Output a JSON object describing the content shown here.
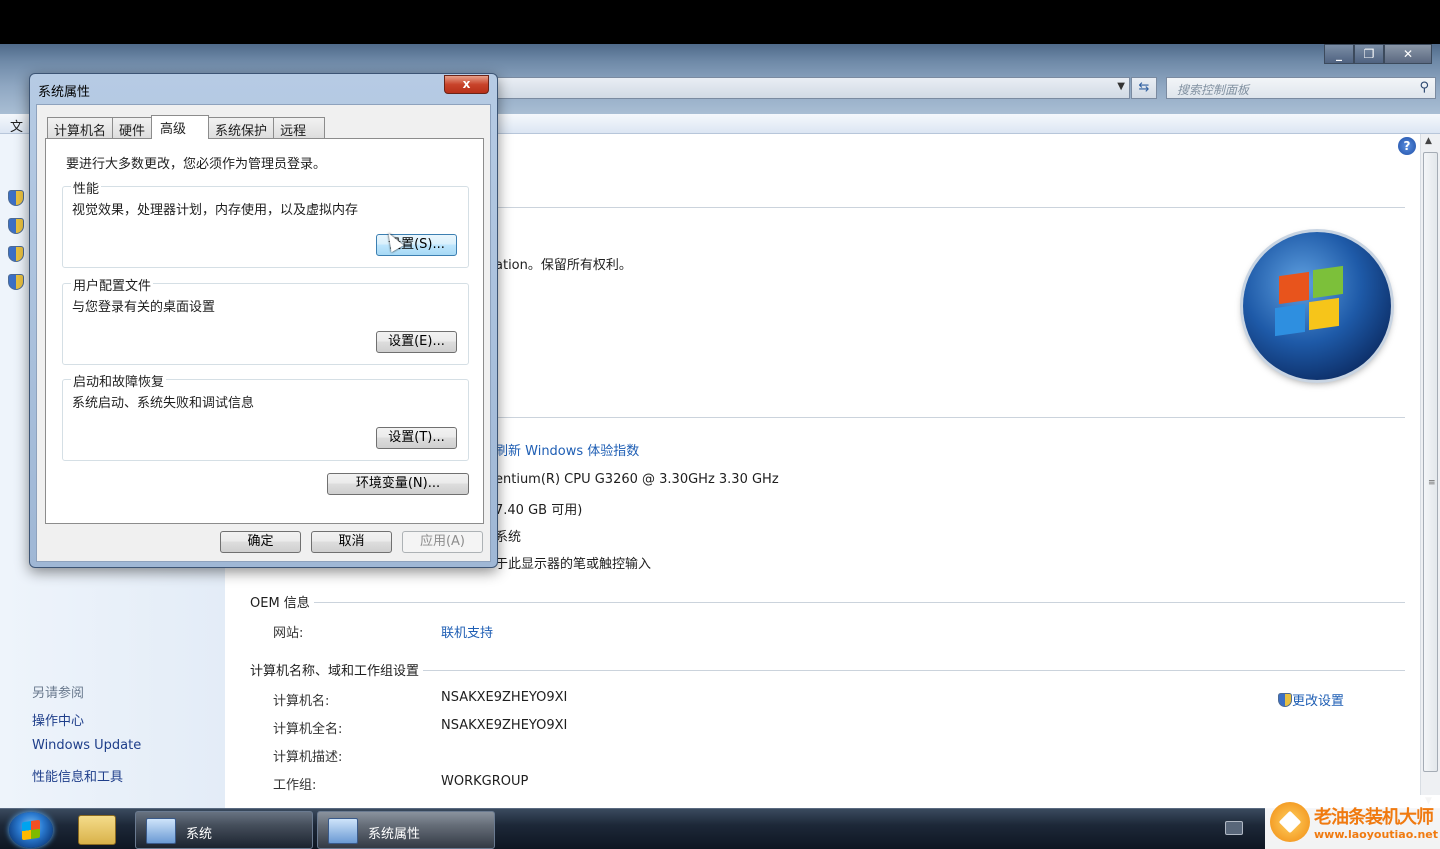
{
  "explorer": {
    "search_placeholder": "搜索控制面板",
    "menu_file": "文",
    "left": {
      "see_also": "另请参阅",
      "links": [
        "操作中心",
        "Windows Update",
        "性能信息和工具"
      ]
    },
    "system_info": {
      "copyright_fragment": "ation。保留所有权利。",
      "rating_link": "刷新 Windows 体验指数",
      "processor_fragment": "entium(R) CPU G3260 @ 3.30GHz   3.30 GHz",
      "memory_fragment": "7.40 GB 可用)",
      "system_type_fragment": "系统",
      "pen_fragment": "于此显示器的笔或触控输入"
    },
    "oem": {
      "title": "OEM 信息",
      "website_label": "网站:",
      "website_link": "联机支持"
    },
    "computer_name": {
      "title": "计算机名称、域和工作组设置",
      "change_link": "更改设置",
      "rows": [
        {
          "label": "计算机名:",
          "value": "NSAKXE9ZHEYO9XI"
        },
        {
          "label": "计算机全名:",
          "value": "NSAKXE9ZHEYO9XI"
        },
        {
          "label": "计算机描述:",
          "value": ""
        },
        {
          "label": "工作组:",
          "value": "WORKGROUP"
        }
      ]
    }
  },
  "dialog": {
    "title": "系统属性",
    "close_label": "x",
    "tabs": [
      "计算机名",
      "硬件",
      "高级",
      "系统保护",
      "远程"
    ],
    "active_tab": "高级",
    "notice": "要进行大多数更改，您必须作为管理员登录。",
    "groups": [
      {
        "title": "性能",
        "desc": "视觉效果，处理器计划，内存使用，以及虚拟内存",
        "button": "设置(S)..."
      },
      {
        "title": "用户配置文件",
        "desc": "与您登录有关的桌面设置",
        "button": "设置(E)..."
      },
      {
        "title": "启动和故障恢复",
        "desc": "系统启动、系统失败和调试信息",
        "button": "设置(T)..."
      }
    ],
    "env_button": "环境变量(N)...",
    "ok": "确定",
    "cancel": "取消",
    "apply": "应用(A)"
  },
  "taskbar": {
    "items": [
      {
        "label": "系统"
      },
      {
        "label": "系统属性"
      }
    ]
  },
  "watermark": {
    "main": "老油条装机大师",
    "url": "www.laoyoutiao.net"
  }
}
